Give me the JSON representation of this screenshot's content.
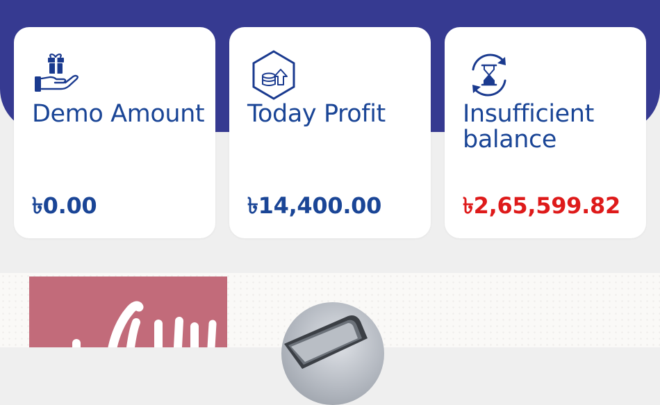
{
  "theme": {
    "header_color": "#363a91",
    "label_color": "#1a4596",
    "negative_color": "#de1a1a",
    "card_background": "#ffffff",
    "page_background": "#efefef"
  },
  "cards": [
    {
      "icon": "gift-hand-icon",
      "label": "Demo Amount",
      "amount": "৳0.00"
    },
    {
      "icon": "coins-growth-icon",
      "label": "Today Profit",
      "amount": "৳14,400.00"
    },
    {
      "icon": "hourglass-refresh-icon",
      "label": "Insufficient balance",
      "amount": "৳2,65,599.82",
      "amount_status": "negative"
    }
  ],
  "banner": {
    "promo_tile_color": "#c26b7a",
    "device_image": "phone-image"
  }
}
